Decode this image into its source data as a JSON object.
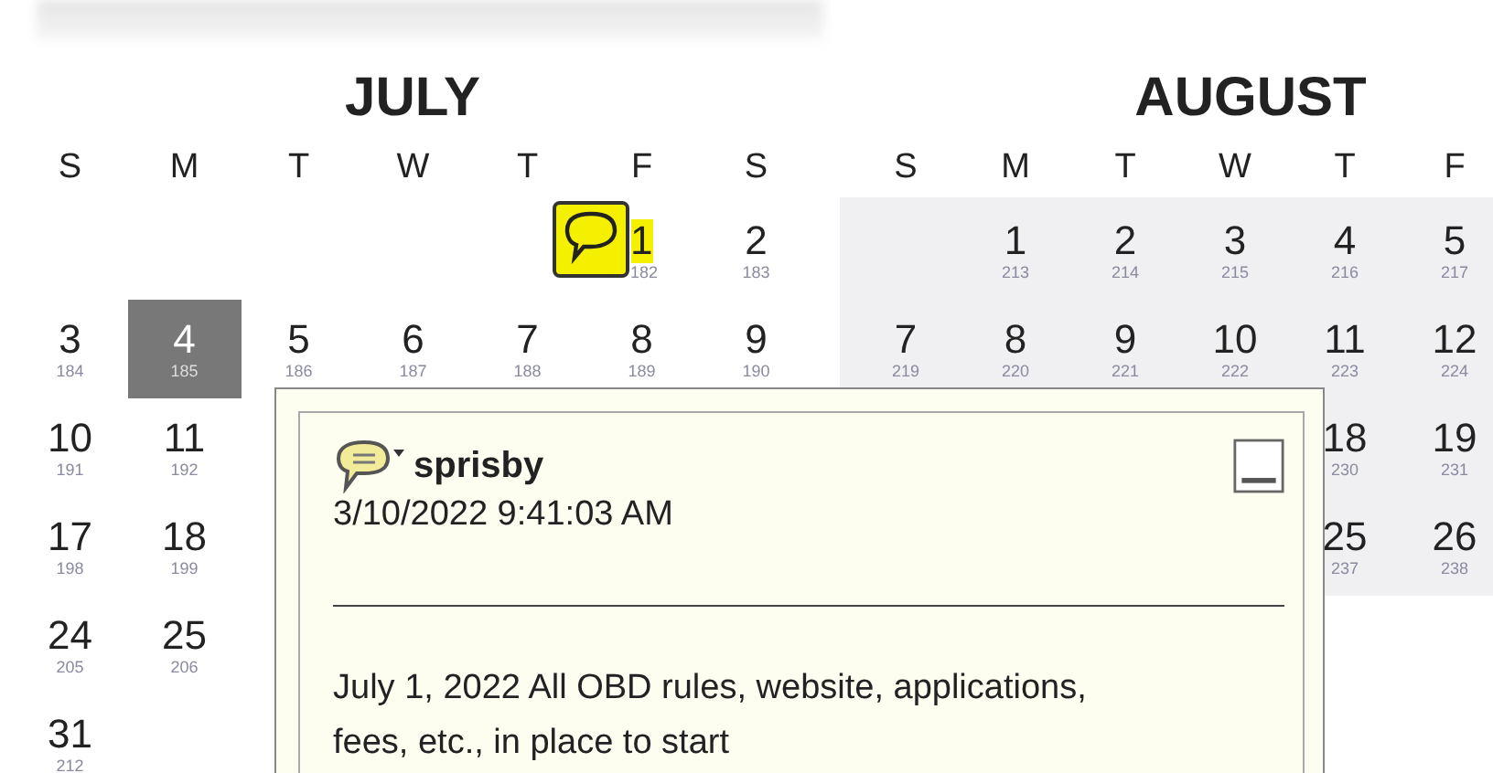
{
  "months": [
    {
      "name": "JULY",
      "weekdays": [
        "S",
        "M",
        "T",
        "W",
        "T",
        "F",
        "S"
      ],
      "weeks": [
        {
          "right_aligned": true,
          "cells": [
            {
              "day": "1",
              "num": "182",
              "selected": false,
              "note": true
            },
            {
              "day": "2",
              "num": "183",
              "selected": false,
              "note": false
            }
          ]
        },
        {
          "cells": [
            {
              "day": "3",
              "num": "184",
              "selected": false,
              "note": false
            },
            {
              "day": "4",
              "num": "185",
              "selected": true,
              "note": false
            },
            {
              "day": "5",
              "num": "186",
              "selected": false,
              "note": false
            },
            {
              "day": "6",
              "num": "187",
              "selected": false,
              "note": false
            },
            {
              "day": "7",
              "num": "188",
              "selected": false,
              "note": false
            },
            {
              "day": "8",
              "num": "189",
              "selected": false,
              "note": false
            },
            {
              "day": "9",
              "num": "190",
              "selected": false,
              "note": false
            }
          ]
        },
        {
          "right_aligned": false,
          "cells": [
            {
              "day": "10",
              "num": "191",
              "selected": false,
              "note": false
            },
            {
              "day": "11",
              "num": "192",
              "selected": false,
              "note": false
            }
          ]
        },
        {
          "right_aligned": false,
          "cells": [
            {
              "day": "17",
              "num": "198",
              "selected": false,
              "note": false
            },
            {
              "day": "18",
              "num": "199",
              "selected": false,
              "note": false
            }
          ]
        },
        {
          "right_aligned": false,
          "cells": [
            {
              "day": "24",
              "num": "205",
              "selected": false,
              "note": false
            },
            {
              "day": "25",
              "num": "206",
              "selected": false,
              "note": false
            }
          ]
        },
        {
          "right_aligned": false,
          "cells": [
            {
              "day": "31",
              "num": "212",
              "selected": false,
              "note": false
            }
          ]
        }
      ]
    },
    {
      "name": "AUGUST",
      "weekdays": [
        "S",
        "M",
        "T",
        "W",
        "T",
        "F"
      ],
      "weeks": [
        {
          "right_aligned": true,
          "cells": [
            {
              "day": "1",
              "num": "213",
              "selected": false,
              "note": false
            },
            {
              "day": "2",
              "num": "214",
              "selected": false,
              "note": false
            },
            {
              "day": "3",
              "num": "215",
              "selected": false,
              "note": false
            },
            {
              "day": "4",
              "num": "216",
              "selected": false,
              "note": false
            },
            {
              "day": "5",
              "num": "217",
              "selected": false,
              "note": false
            }
          ]
        },
        {
          "cells": [
            {
              "day": "7",
              "num": "219",
              "selected": false,
              "note": false
            },
            {
              "day": "8",
              "num": "220",
              "selected": false,
              "note": false
            },
            {
              "day": "9",
              "num": "221",
              "selected": false,
              "note": false
            },
            {
              "day": "10",
              "num": "222",
              "selected": false,
              "note": false
            },
            {
              "day": "11",
              "num": "223",
              "selected": false,
              "note": false
            },
            {
              "day": "12",
              "num": "224",
              "selected": false,
              "note": false
            }
          ]
        },
        {
          "right_aligned": true,
          "cells": [
            {
              "day": "18",
              "num": "230",
              "selected": false,
              "note": false
            },
            {
              "day": "19",
              "num": "231",
              "selected": false,
              "note": false
            }
          ]
        },
        {
          "right_aligned": true,
          "cells": [
            {
              "day": "25",
              "num": "237",
              "selected": false,
              "note": false
            },
            {
              "day": "26",
              "num": "238",
              "selected": false,
              "note": false
            }
          ]
        }
      ]
    }
  ],
  "note_popup": {
    "author": "sprisby",
    "timestamp": "3/10/2022 9:41:03 AM",
    "text": "July 1, 2022 All OBD rules, website, applications, fees, etc., in place to start"
  }
}
